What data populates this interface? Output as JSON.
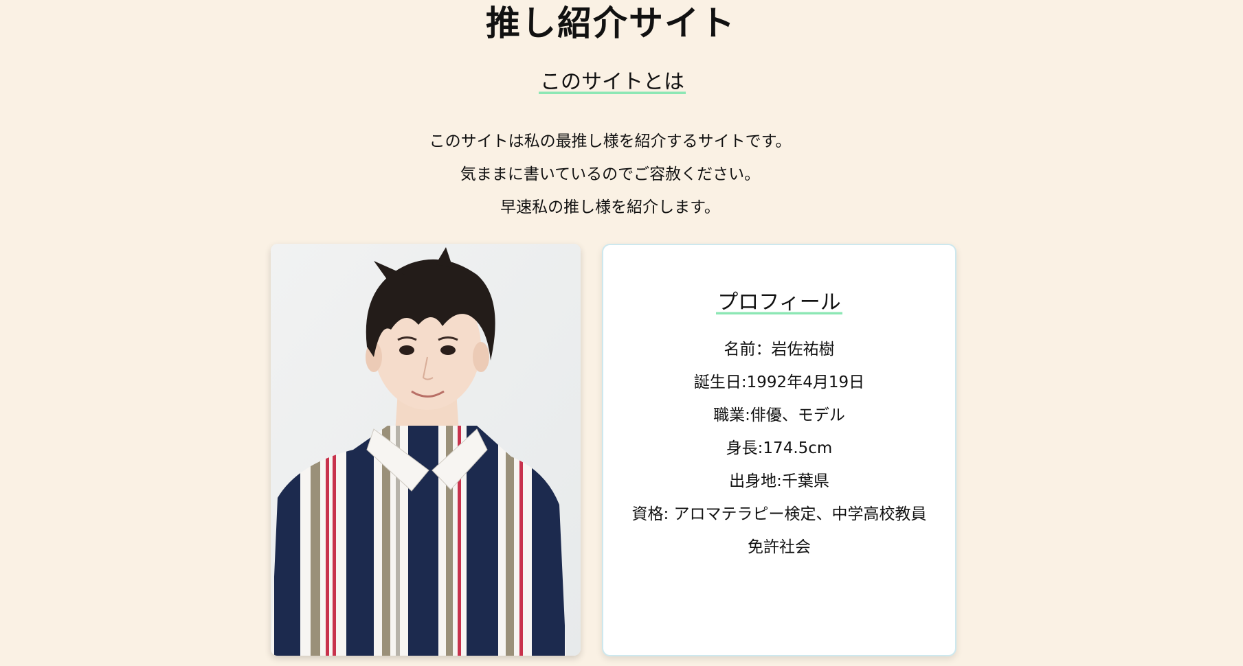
{
  "page": {
    "title": "推し紹介サイト"
  },
  "about": {
    "heading": "このサイトとは",
    "paragraphs": [
      "このサイトは私の最推し様を紹介するサイトです。",
      "気ままに書いているのでご容赦ください。",
      "早速私の推し様を紹介します。"
    ]
  },
  "profile": {
    "heading": "プロフィール",
    "items": [
      "名前：岩佐祐樹",
      "誕生日:1992年4月19日",
      "職業:俳優、モデル",
      "身長:174.5cm",
      "出身地:千葉県",
      "資格: アロマテラピー検定、中学高校教員免許社会"
    ]
  },
  "photo": {
    "description_icon": "portrait-photo"
  },
  "colors": {
    "background": "#faf1e4",
    "underline_accent": "#8ce7b4",
    "card_border": "#cde8ee"
  }
}
